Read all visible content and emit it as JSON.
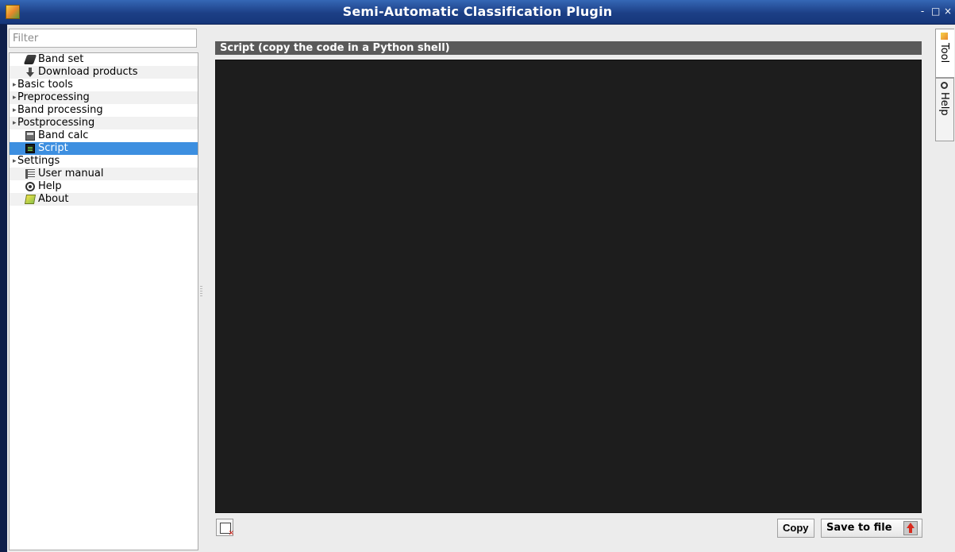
{
  "window": {
    "title": "Semi-Automatic Classification Plugin",
    "controls": [
      "-",
      "□",
      "×"
    ]
  },
  "filter": {
    "placeholder": "Filter",
    "value": ""
  },
  "tree": [
    {
      "label": "Band set",
      "icon": "band-set-icon",
      "expandable": false,
      "selected": false
    },
    {
      "label": "Download products",
      "icon": "download-icon",
      "expandable": false,
      "selected": false
    },
    {
      "label": "Basic tools",
      "icon": "",
      "expandable": true,
      "selected": false
    },
    {
      "label": "Preprocessing",
      "icon": "",
      "expandable": true,
      "selected": false
    },
    {
      "label": "Band processing",
      "icon": "",
      "expandable": true,
      "selected": false
    },
    {
      "label": "Postprocessing",
      "icon": "",
      "expandable": true,
      "selected": false
    },
    {
      "label": "Band calc",
      "icon": "calculator-icon",
      "expandable": false,
      "selected": false
    },
    {
      "label": "Script",
      "icon": "script-icon",
      "expandable": false,
      "selected": true
    },
    {
      "label": "Settings",
      "icon": "",
      "expandable": true,
      "selected": false
    },
    {
      "label": "User manual",
      "icon": "manual-icon",
      "expandable": false,
      "selected": false
    },
    {
      "label": "Help",
      "icon": "help-icon",
      "expandable": false,
      "selected": false
    },
    {
      "label": "About",
      "icon": "about-icon",
      "expandable": false,
      "selected": false
    }
  ],
  "script": {
    "header": "Script (copy the code in a Python shell)",
    "code": ""
  },
  "buttons": {
    "copy": "Copy",
    "save": "Save to file"
  },
  "side_tabs": {
    "tool": "Tool",
    "help": "Help"
  },
  "colors": {
    "titlebar": "#1c3f86",
    "selected": "#3d8fe0",
    "code_background": "#1d1d1d"
  }
}
